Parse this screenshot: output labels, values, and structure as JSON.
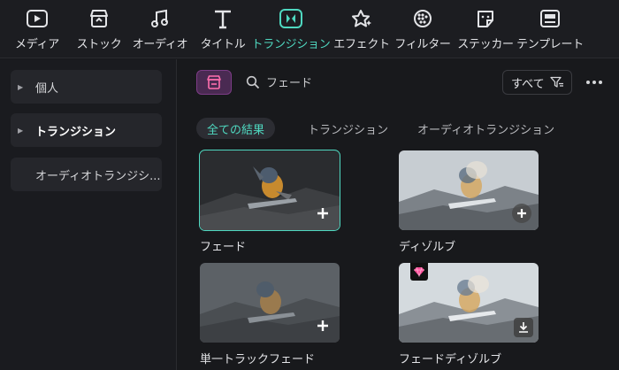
{
  "toolbar": {
    "items": [
      {
        "label": "メディア",
        "icon": "media-icon"
      },
      {
        "label": "ストック",
        "icon": "stock-icon"
      },
      {
        "label": "オーディオ",
        "icon": "music-note-icon"
      },
      {
        "label": "タイトル",
        "icon": "title-t-icon"
      },
      {
        "label": "トランジション",
        "icon": "transition-icon",
        "active": true
      },
      {
        "label": "エフェクト",
        "icon": "effect-star-icon"
      },
      {
        "label": "フィルター",
        "icon": "filter-icon"
      },
      {
        "label": "ステッカー",
        "icon": "sticker-icon"
      },
      {
        "label": "テンプレート",
        "icon": "template-icon"
      }
    ],
    "accent_color": "#4fd8c0"
  },
  "sidebar": {
    "items": [
      {
        "label": "個人",
        "expandable": true
      },
      {
        "label": "トランジション",
        "expandable": true,
        "selected": true
      },
      {
        "label": "オーディオトランジシ...",
        "expandable": false
      }
    ]
  },
  "search": {
    "value": "フェード",
    "filter_label": "すべて"
  },
  "tabs": [
    {
      "label": "全ての結果",
      "active": true
    },
    {
      "label": "トランジション"
    },
    {
      "label": "オーディオトランジション"
    }
  ],
  "cards": [
    {
      "label": "フェード",
      "selected": true,
      "action_icon": "add-icon"
    },
    {
      "label": "ディゾルブ",
      "action_icon": "add-icon"
    },
    {
      "label": "単一トラックフェード",
      "action_icon": "add-icon"
    },
    {
      "label": "フェードディゾルブ",
      "premium": true,
      "action_icon": "download-icon"
    }
  ],
  "colors": {
    "background": "#18191c",
    "panel": "#25262b",
    "premium_gem": "#ff4f9a",
    "store_button": "#4a2a52"
  }
}
